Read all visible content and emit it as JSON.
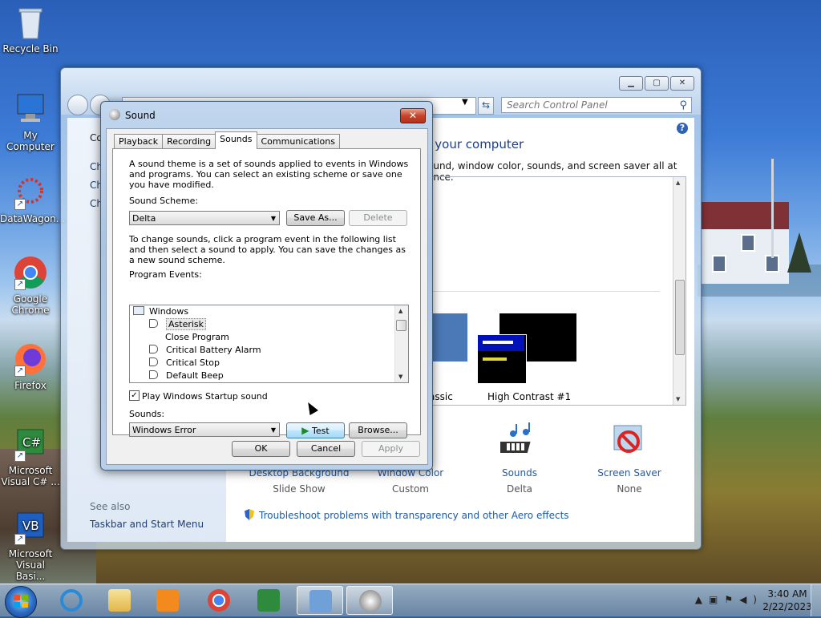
{
  "desktop": {
    "icons": [
      {
        "label": "Recycle Bin"
      },
      {
        "label": "My Computer"
      },
      {
        "label": "DataWagon..."
      },
      {
        "label": "Google Chrome"
      },
      {
        "label": "Firefox"
      },
      {
        "label": "Microsoft Visual C# ..."
      },
      {
        "label": "Microsoft Visual Basi..."
      }
    ]
  },
  "control_panel": {
    "search_placeholder": "Search Control Panel",
    "title": "n your computer",
    "subtitle": "ound, window color, sounds, and screen saver all at once.",
    "left_links": [
      "Co",
      "Ch",
      "Ch",
      "Ch"
    ],
    "see_also": "See also",
    "see_also_link": "Taskbar and Start Menu",
    "themes": [
      {
        "label": "assic"
      },
      {
        "label": "High Contrast #1"
      }
    ],
    "bottom_items": [
      {
        "name": "Desktop Background",
        "value": "Slide Show"
      },
      {
        "name": "Window Color",
        "value": "Custom"
      },
      {
        "name": "Sounds",
        "value": "Delta"
      },
      {
        "name": "Screen Saver",
        "value": "None"
      }
    ],
    "troubleshoot": "Troubleshoot problems with transparency and other Aero effects"
  },
  "sound_dialog": {
    "title": "Sound",
    "close": "✕",
    "tabs": [
      "Playback",
      "Recording",
      "Sounds",
      "Communications"
    ],
    "active_tab": "Sounds",
    "description": "A sound theme is a set of sounds applied to events in Windows and programs.  You can select an existing scheme or save one you have modified.",
    "scheme_label": "Sound Scheme:",
    "scheme_value": "Delta",
    "save_as": "Save As...",
    "delete": "Delete",
    "instructions": "To change sounds, click a program event in the following list and then select a sound to apply.  You can save the changes as a new sound scheme.",
    "events_label": "Program Events:",
    "events": [
      {
        "label": "Windows",
        "level": 0
      },
      {
        "label": "Asterisk",
        "level": 1
      },
      {
        "label": "Close Program",
        "level": 1
      },
      {
        "label": "Critical Battery Alarm",
        "level": 1
      },
      {
        "label": "Critical Stop",
        "level": 1
      },
      {
        "label": "Default Beep",
        "level": 1
      }
    ],
    "selected_event": "Asterisk",
    "startup_label": "Play Windows Startup sound",
    "startup_checked": true,
    "sounds_label": "Sounds:",
    "sound_value": "Windows Error",
    "test": "Test",
    "browse": "Browse...",
    "ok": "OK",
    "cancel": "Cancel",
    "apply": "Apply"
  },
  "taskbar": {
    "time": "3:40 AM",
    "date": "2/22/2023"
  },
  "colors": {
    "link": "#1e5aa8",
    "dialog_frame": "#a9c3e2",
    "close_red": "#c7442a"
  }
}
